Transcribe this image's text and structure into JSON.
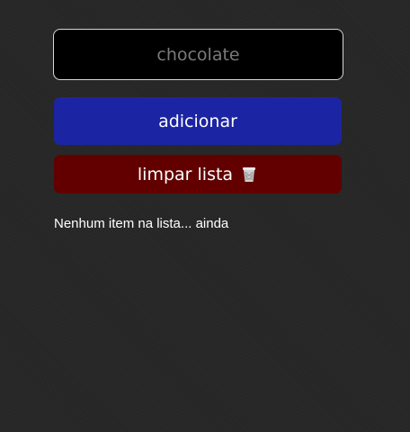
{
  "form": {
    "input_value": "",
    "input_placeholder": "chocolate",
    "add_label": "adicionar",
    "clear_label": "limpar lista",
    "clear_icon": "wastebasket-icon"
  },
  "list": {
    "empty_message": "Nenhum item na lista... ainda",
    "items": []
  },
  "colors": {
    "background": "#262626",
    "input_background": "#000000",
    "input_border": "#d8d8d8",
    "add_button": "#1b25a3",
    "clear_button": "#620000",
    "text": "#ffffff"
  }
}
